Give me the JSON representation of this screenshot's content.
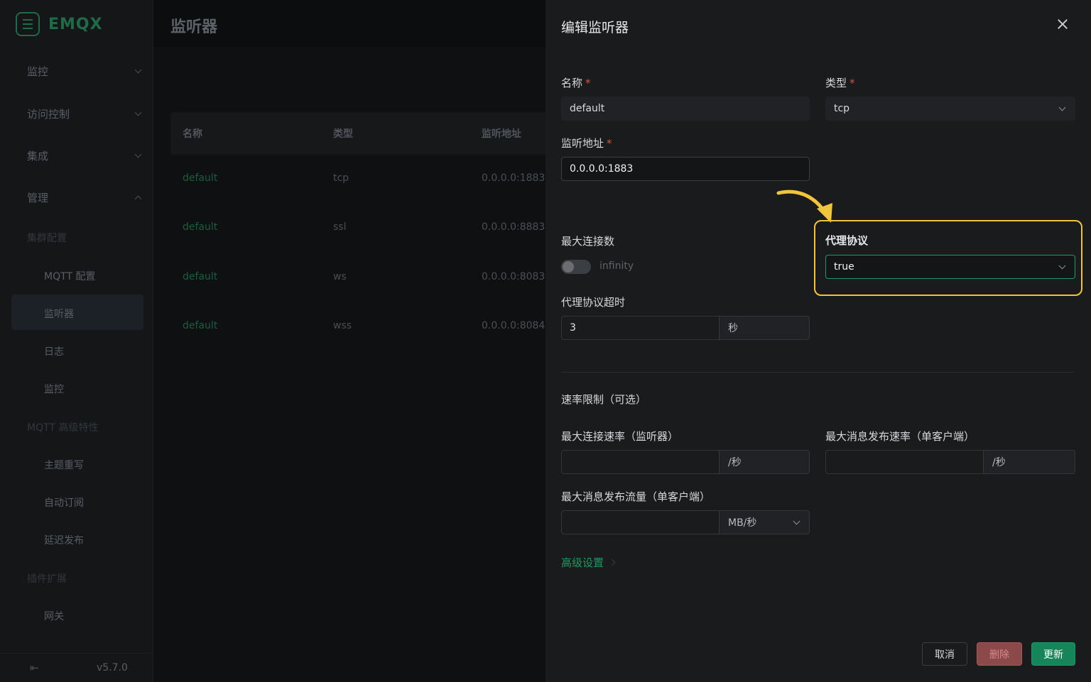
{
  "sidebar": {
    "logo": "EMQX",
    "groups": [
      "监控",
      "访问控制",
      "集成",
      "管理"
    ],
    "sections": [
      "集群配置",
      "MQTT 高级特性",
      "插件扩展"
    ],
    "items": {
      "mqtt_config": "MQTT 配置",
      "listeners": "监听器",
      "logs": "日志",
      "monitor": "监控",
      "topic_rewrite": "主题重写",
      "auto_subscribe": "自动订阅",
      "delayed_publish": "延迟发布",
      "gateway": "网关"
    },
    "collapse_icon": "集",
    "version": "v5.7.0"
  },
  "page": {
    "title": "监听器",
    "table": {
      "headers": [
        "名称",
        "类型",
        "监听地址"
      ],
      "rows": [
        {
          "name": "default",
          "type": "tcp",
          "address": "0.0.0.0:1883"
        },
        {
          "name": "default",
          "type": "ssl",
          "address": "0.0.0.0:8883"
        },
        {
          "name": "default",
          "type": "ws",
          "address": "0.0.0.0:8083"
        },
        {
          "name": "default",
          "type": "wss",
          "address": "0.0.0.0:8084"
        }
      ]
    }
  },
  "drawer": {
    "title": "编辑监听器",
    "name_label": "名称",
    "name_value": "default",
    "type_label": "类型",
    "type_value": "tcp",
    "bind_label": "监听地址",
    "bind_value": "0.0.0.0:1883",
    "max_conn_label": "最大连接数",
    "max_conn_toggle_text": "infinity",
    "proxy_label": "代理协议",
    "proxy_value": "true",
    "proxy_timeout_label": "代理协议超时",
    "proxy_timeout_value": "3",
    "proxy_timeout_unit": "秒",
    "rate_section": "速率限制（可选）",
    "max_conn_rate_label": "最大连接速率（监听器）",
    "max_conn_rate_unit": "/秒",
    "max_msg_rate_label": "最大消息发布速率（单客户端）",
    "max_msg_rate_unit": "/秒",
    "max_bytes_label": "最大消息发布流量（单客户端）",
    "max_bytes_unit": "MB/秒",
    "advanced_link": "高级设置",
    "buttons": {
      "cancel": "取消",
      "delete": "删除",
      "update": "更新"
    }
  },
  "colors": {
    "accent": "#1d9a62",
    "highlight": "#f0c53d",
    "danger": "#8b4949"
  }
}
